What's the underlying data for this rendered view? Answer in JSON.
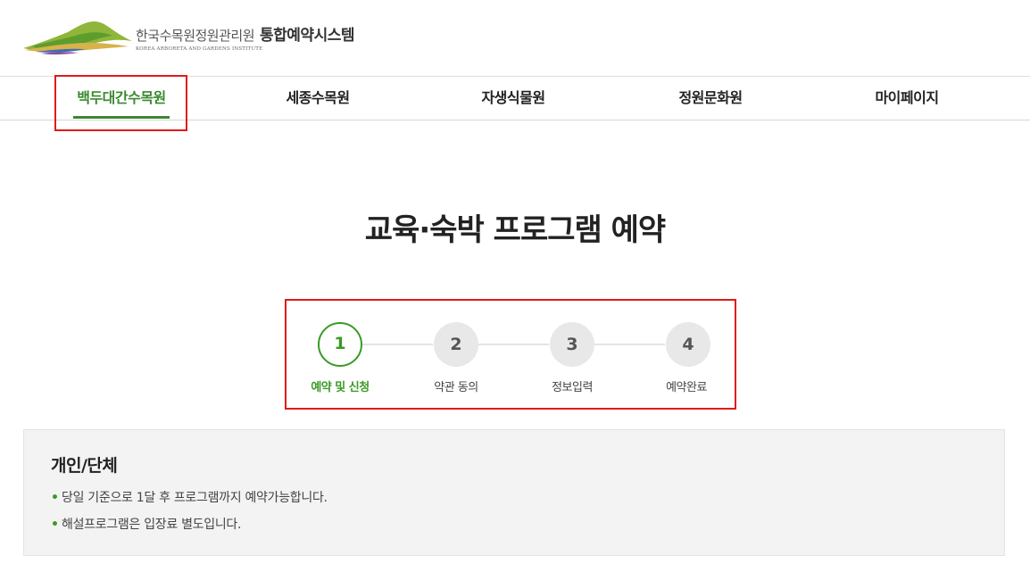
{
  "header": {
    "org_name": "한국수목원정원관리원",
    "org_name_en": "KOREA ARBORETA AND GARDENS INSTITUTE",
    "system_name": "통합예약시스템"
  },
  "nav": {
    "items": [
      {
        "label": "백두대간수목원",
        "active": true
      },
      {
        "label": "세종수목원",
        "active": false
      },
      {
        "label": "자생식물원",
        "active": false
      },
      {
        "label": "정원문화원",
        "active": false
      },
      {
        "label": "마이페이지",
        "active": false
      }
    ]
  },
  "page_title": "교육·숙박 프로그램 예약",
  "steps": [
    {
      "number": "1",
      "label": "예약 및 신청",
      "active": true
    },
    {
      "number": "2",
      "label": "약관 동의",
      "active": false
    },
    {
      "number": "3",
      "label": "정보입력",
      "active": false
    },
    {
      "number": "4",
      "label": "예약완료",
      "active": false
    }
  ],
  "info": {
    "title": "개인/단체",
    "items": [
      "당일 기준으로 1달 후 프로그램까지 예약가능합니다.",
      "해설프로그램은 입장료 별도입니다."
    ]
  },
  "colors": {
    "accent_green": "#3a8a2f",
    "highlight_red": "#e01a1a"
  }
}
